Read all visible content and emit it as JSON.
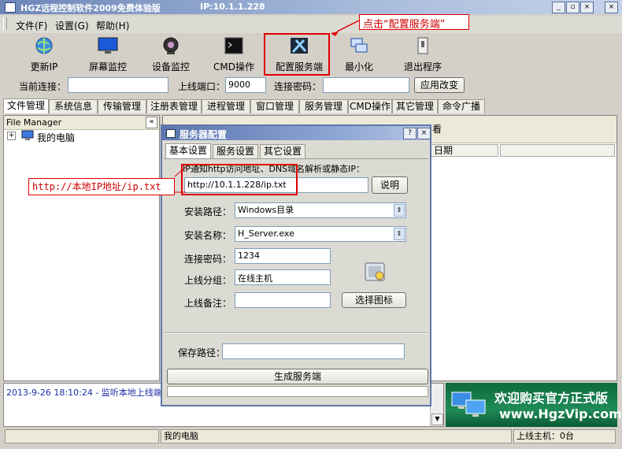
{
  "window": {
    "title": "HGZ远程控制软件2009免费体验版",
    "ip": "IP:10.1.1.228",
    "buttons": [
      "_",
      "▫",
      "×",
      "×"
    ]
  },
  "menu": [
    "文件(F)",
    "设置(G)",
    "帮助(H)"
  ],
  "toolbar": [
    {
      "label": "更新IP",
      "icon": "globe-icon"
    },
    {
      "label": "屏幕监控",
      "icon": "monitor-icon"
    },
    {
      "label": "设备监控",
      "icon": "webcam-icon"
    },
    {
      "label": "CMD操作",
      "icon": "console-icon"
    },
    {
      "label": "配置服务端",
      "icon": "server-config-icon"
    },
    {
      "label": "最小化",
      "icon": "minimize-window-icon"
    },
    {
      "label": "退出程序",
      "icon": "exit-icon"
    }
  ],
  "connection": {
    "current_label": "当前连接：",
    "port_label": "上线端口：",
    "port_value": "9000",
    "password_label": "连接密码：",
    "apply_label": "应用改变"
  },
  "tabs": [
    "文件管理",
    "系统信息",
    "传输管理",
    "注册表管理",
    "进程管理",
    "窗口管理",
    "服务管理",
    "CMD操作",
    "其它管理",
    "命令广播"
  ],
  "file_manager": {
    "title": "File Manager",
    "tree_root": "我的电脑",
    "collapse": "«"
  },
  "right_pane": {
    "view_label": "看",
    "col_date": "日期"
  },
  "log": {
    "line": "2013-9-26 18:10:24 - 监听本地上线端"
  },
  "ad": {
    "line1": "欢迎购买官方正式版",
    "line2": "www.HgzVip.com"
  },
  "status": {
    "item": "我的电脑",
    "online": "上线主机：0台"
  },
  "dialog": {
    "title": "服务器配置",
    "tabs": [
      "基本设置",
      "服务设置",
      "其它设置"
    ],
    "url_hint": "IP通知http访问地址、DNS域名解析或静态IP：",
    "url_value": "http://10.1.1.228/ip.txt",
    "explain_label": "说明",
    "install_path_label": "安装路径：",
    "install_path_value": "Windows目录",
    "install_name_label": "安装名称：",
    "install_name_value": "H_Server.exe",
    "password_label": "连接密码：",
    "password_value": "1234",
    "group_label": "上线分组：",
    "group_value": "在线主机",
    "note_label": "上线备注：",
    "note_value": "",
    "icon_button_label": "选择图标",
    "save_path_label": "保存路径：",
    "generate_label": "生成服务端"
  },
  "annotations": {
    "top": "点击“配置服务端”",
    "left": "http://本地IP地址/ip.txt"
  },
  "colors": {
    "title_blue": "#6c86b8",
    "annotation_red": "#e00000",
    "ad_green": "#1e8b56"
  }
}
